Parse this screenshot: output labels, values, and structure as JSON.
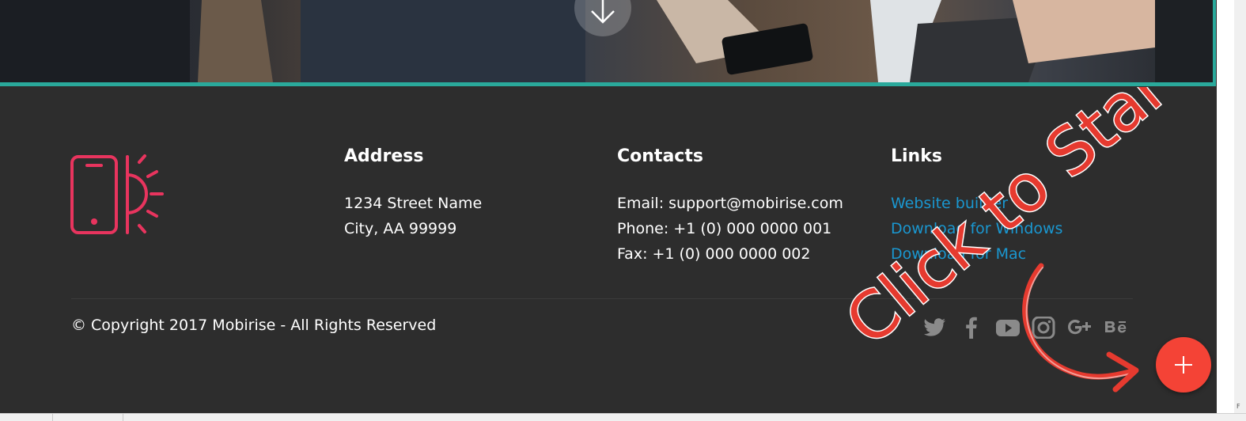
{
  "footer": {
    "address": {
      "title": "Address",
      "lines": [
        "1234 Street Name",
        "City, AA 99999"
      ]
    },
    "contacts": {
      "title": "Contacts",
      "lines": [
        "Email: support@mobirise.com",
        "Phone: +1 (0) 000 0000 001",
        "Fax: +1 (0) 000 0000 002"
      ]
    },
    "links": {
      "title": "Links",
      "items": [
        "Website builder",
        "Download for Windows",
        "Download for Mac"
      ]
    },
    "copyright": "© Copyright 2017 Mobirise - All Rights Reserved",
    "social_icons": [
      "twitter-icon",
      "facebook-icon",
      "youtube-icon",
      "instagram-icon",
      "google-plus-icon",
      "behance-icon"
    ]
  },
  "overlay": {
    "text": "Click to Start"
  },
  "corner_tip": "F",
  "colors": {
    "background": "#2d2d2d",
    "accent_teal": "#2aa99b",
    "logo_pink": "#e8345e",
    "link_blue": "#1a97d0",
    "fab_red": "#f44336",
    "social_gray": "#8a8a8a"
  }
}
